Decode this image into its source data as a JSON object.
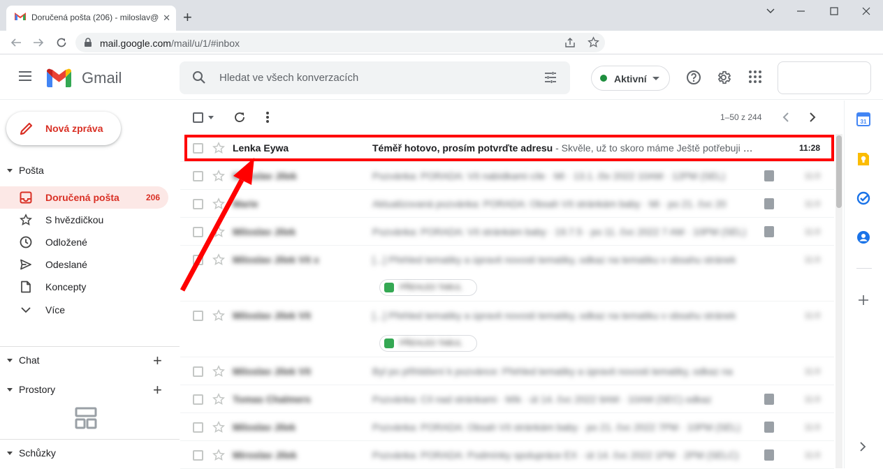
{
  "browser": {
    "tab_title": "Doručená pošta (206) - miloslav@",
    "tab_close": "✕",
    "new_tab": "+",
    "url_host": "mail.google.com",
    "url_path": "/mail/u/1/#inbox"
  },
  "header": {
    "app_name": "Gmail",
    "search_placeholder": "Hledat ve všech konverzacích",
    "status_label": "Aktivní"
  },
  "sidebar": {
    "compose_label": "Nová zpráva",
    "mail_section": "Pošta",
    "items": [
      {
        "label": "Doručená pošta",
        "count": "206",
        "icon": "inbox-icon"
      },
      {
        "label": "S hvězdičkou",
        "icon": "star-icon"
      },
      {
        "label": "Odložené",
        "icon": "clock-icon"
      },
      {
        "label": "Odeslané",
        "icon": "send-icon"
      },
      {
        "label": "Koncepty",
        "icon": "draft-icon"
      },
      {
        "label": "Více",
        "icon": "chevron-down-icon"
      }
    ],
    "chat_section": "Chat",
    "spaces_section": "Prostory",
    "meet_section": "Schůzky"
  },
  "toolbar": {
    "range": "1–50 z 244"
  },
  "mails": [
    {
      "sender": "Lenka Eywa",
      "subject": "Téměř hotovo, prosím potvrďte adresu",
      "snippet": " - Skvěle, už to skoro máme Ještě potřebuji o...",
      "time": "11:28"
    },
    {
      "sender": "Miroslav Jílek",
      "subject": "Pozvánka: PORADA: Vít nabídkami cíle · MI · 13.1. čtv 2022 10AM · 12PM (SEL)",
      "snippet": "",
      "time": "11:0"
    },
    {
      "sender": "Marie",
      "subject": "Aktualizovaná pozvánka: PORADA: Obsah Vít stránkám baby · Mi · po 21. čvc 20",
      "snippet": "",
      "time": "11:0"
    },
    {
      "sender": "Miloslav Jílek",
      "subject": "Pozvánka: PORADA: Vít stránkám baby · 19.7.5 · po 11. čvc 2022 7 AM · 10PM (SEL)",
      "snippet": "",
      "time": "11:0"
    },
    {
      "sender": "Miloslav Jílek Vít x",
      "subject": "[...] Přehled tematiky a úpravit novosti tematiky, odkaz na tematiku v obsahu stránek",
      "snippet": "",
      "time": "11:0",
      "chip": "PŘEHLED TABUL"
    },
    {
      "sender": "Miloslav Jílek Vít",
      "subject": "[...] Přehled tematiky a úpravit novosti tematiky, odkaz na tematiku v obsahu stránek",
      "snippet": "",
      "time": "11:0",
      "chip": "PŘEHLED TABUL"
    },
    {
      "sender": "Miloslav Jílek Vít",
      "subject": "Byl po přihlášení k pozvánce: Přehled tematiky a úpravit novosti tematiky, odkaz na",
      "snippet": "",
      "time": "11:0"
    },
    {
      "sender": "Tomas Chalmers",
      "subject": "Pozvánka: Cíl nad stránkami · Mík · út 14. čvc 2022 9AM · 10AM (SEC) odkaz",
      "snippet": "",
      "time": "11:0"
    },
    {
      "sender": "Miloslav Jílek",
      "subject": "Pozvánka: PORADA: Obsah Vít stránkám baby · po 21. čvc 2022 7PM · 10PM (SEL)",
      "snippet": "",
      "time": "11:0"
    },
    {
      "sender": "Miroslav Jílek",
      "subject": "Pozvánka: PORADA: Podmínky spolupráce EX · út 14. čvc 2022 1PM · 2PM (SELC)",
      "snippet": "",
      "time": "11:0"
    }
  ],
  "colors": {
    "accent_red": "#d93025",
    "highlight_red": "#ff0000",
    "active_bg": "#fce8e6",
    "status_green": "#1e8e3e"
  }
}
